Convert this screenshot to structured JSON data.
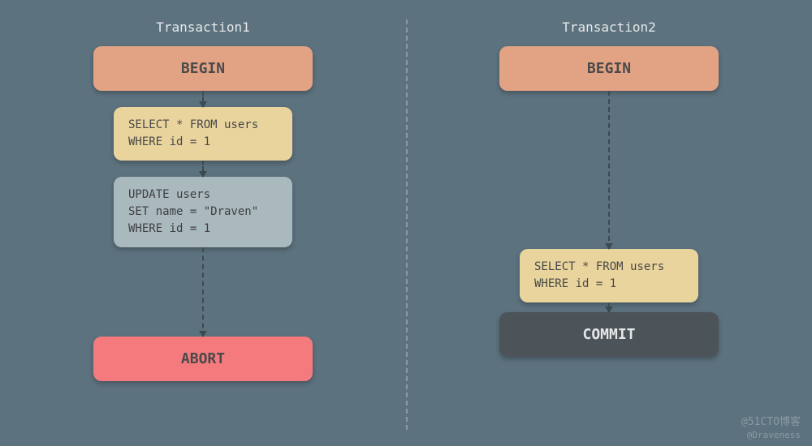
{
  "chart_data": {
    "type": "table",
    "title": "Transaction isolation sequence diagram",
    "columns": [
      "Transaction1",
      "Transaction2"
    ],
    "rows": [
      [
        "BEGIN",
        "BEGIN"
      ],
      [
        "SELECT * FROM users WHERE id = 1",
        ""
      ],
      [
        "UPDATE users SET name = \"Draven\" WHERE id = 1",
        ""
      ],
      [
        "",
        "SELECT * FROM users WHERE id = 1"
      ],
      [
        "ABORT",
        "COMMIT"
      ]
    ]
  },
  "left": {
    "title": "Transaction1",
    "begin": "BEGIN",
    "select": "SELECT * FROM users\nWHERE id = 1",
    "update": "UPDATE users\nSET name = \"Draven\"\nWHERE id = 1",
    "end": "ABORT"
  },
  "right": {
    "title": "Transaction2",
    "begin": "BEGIN",
    "select": "SELECT * FROM users\nWHERE id = 1",
    "end": "COMMIT"
  },
  "watermark": {
    "line1": "@51CTO博客",
    "line2": "@Draveness"
  },
  "colors": {
    "bg": "#5c727e",
    "begin": "#e2a284",
    "select": "#e9d49d",
    "update": "#a9b9be",
    "abort": "#f47a7e",
    "commit": "#4c545a"
  }
}
